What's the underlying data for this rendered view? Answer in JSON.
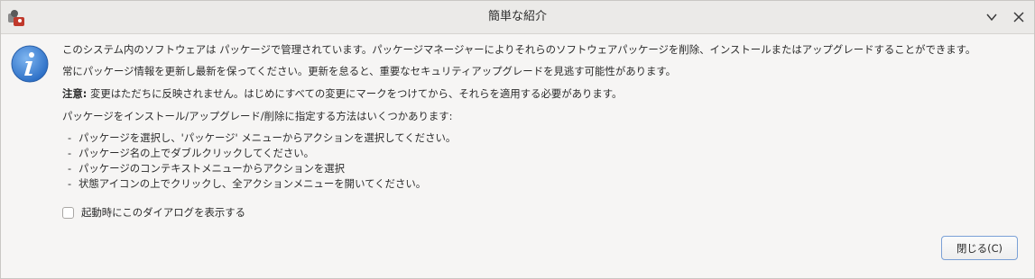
{
  "window": {
    "title": "簡単な紹介",
    "minimize_icon": "chevron-down-icon",
    "close_icon": "close-icon",
    "app_icon": "app-logo-icon"
  },
  "dialog": {
    "info_icon": "info-icon",
    "accent_color": "#3b7dd8",
    "paragraphs": {
      "intro": "このシステム内のソフトウェアは パッケージで管理されています。パッケージマネージャーによりそれらのソフトウェアパッケージを削除、インストールまたはアップグレードすることができます。",
      "update": "常にパッケージ情報を更新し最新を保ってください。更新を怠ると、重要なセキュリティアップグレードを見逃す可能性があります。",
      "note_label": "注意:",
      "note_text": " 変更はただちに反映されません。はじめにすべての変更にマークをつけてから、それらを適用する必要があります。",
      "methods_intro": "パッケージをインストール/アップグレード/削除に指定する方法はいくつかあります:"
    },
    "bullets": [
      "パッケージを選択し、'パッケージ' メニューからアクションを選択してください。",
      "パッケージ名の上でダブルクリックしてください。",
      "パッケージのコンテキストメニューからアクションを選択",
      "状態アイコンの上でクリックし、全アクションメニューを開いてください。"
    ],
    "bullet_dash": "-",
    "checkbox": {
      "label": "起動時にこのダイアログを表示する",
      "checked": false
    },
    "close_button": "閉じる(C)"
  }
}
